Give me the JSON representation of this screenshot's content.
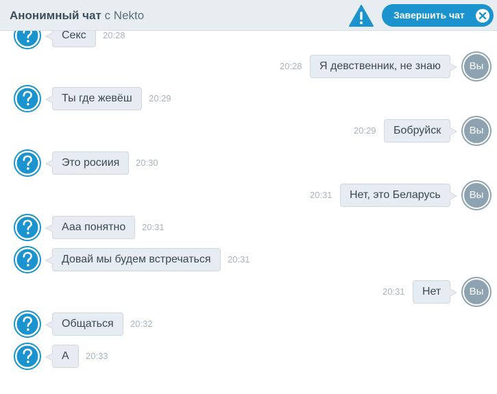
{
  "header": {
    "title_bold": "Анонимный чат",
    "title_rest": "с Nekto",
    "end_chat_label": "Завершить чат"
  },
  "me_label": "Вы",
  "colors": {
    "accent": "#1a93cf",
    "header_bg": "#e8edf2",
    "bubble_bg": "#e6ecf1",
    "me_avatar": "#8ea3b1",
    "time": "#a8b4bd"
  },
  "icons": {
    "warning": "warning-icon",
    "close": "close-circle-icon",
    "stranger_avatar": "question-mark-icon"
  },
  "messages": [
    {
      "from": "stranger",
      "text": "Секс",
      "time": "20:28"
    },
    {
      "from": "me",
      "text": "Я девственник, не знаю",
      "time": "20:28"
    },
    {
      "from": "stranger",
      "text": "Ты где жевёш",
      "time": "20:29"
    },
    {
      "from": "me",
      "text": "Бобруйск",
      "time": "20:29"
    },
    {
      "from": "stranger",
      "text": "Это росиия",
      "time": "20:30"
    },
    {
      "from": "me",
      "text": "Нет, это Беларусь",
      "time": "20:31"
    },
    {
      "from": "stranger",
      "text": "Ааа понятно",
      "time": "20:31"
    },
    {
      "from": "stranger",
      "text": "Довай мы будем встречаться",
      "time": "20:31"
    },
    {
      "from": "me",
      "text": "Нет",
      "time": "20:31"
    },
    {
      "from": "stranger",
      "text": "Общаться",
      "time": "20:32"
    },
    {
      "from": "stranger",
      "text": "А",
      "time": "20:33"
    }
  ]
}
